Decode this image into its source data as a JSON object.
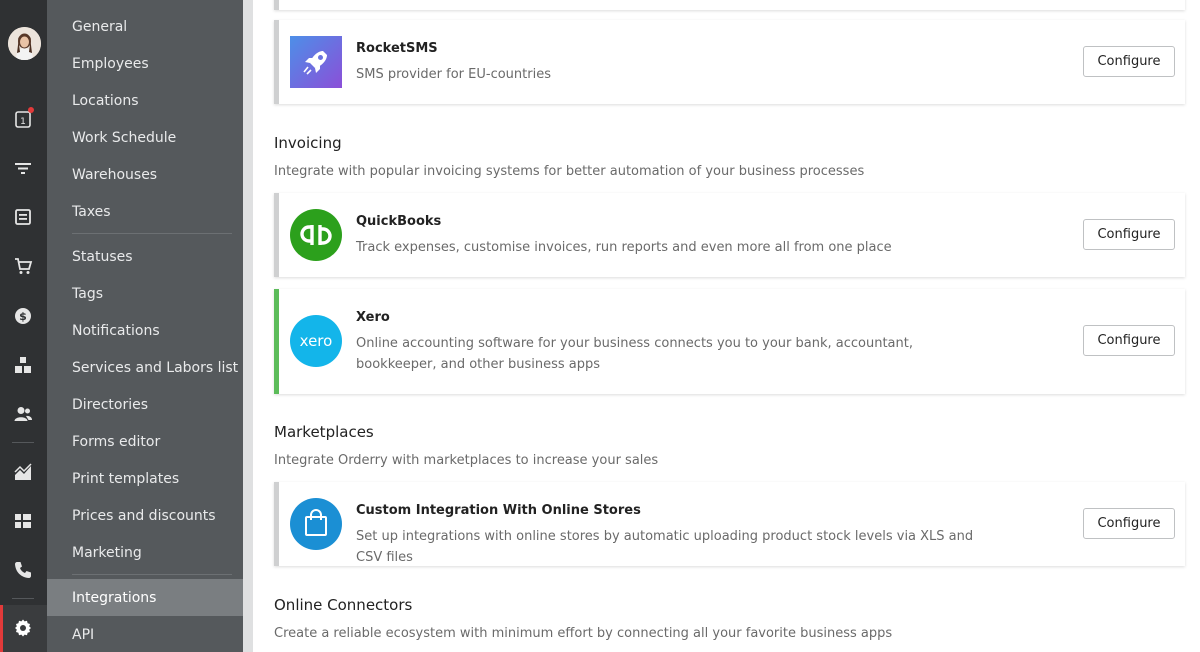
{
  "rail": {
    "icons": [
      "calendar-icon",
      "filter-icon",
      "orders-icon",
      "cart-icon",
      "money-icon",
      "warehouse-icon",
      "contacts-icon",
      "analytics-icon",
      "dashboard-icon",
      "phone-icon",
      "gear-icon"
    ],
    "calendar_day": "1",
    "accent_color": "#e23a3a"
  },
  "menu": {
    "items": [
      "General",
      "Employees",
      "Locations",
      "Work Schedule",
      "Warehouses",
      "Taxes",
      "Statuses",
      "Tags",
      "Notifications",
      "Services and Labors list",
      "Directories",
      "Forms editor",
      "Print templates",
      "Prices and discounts",
      "Marketing",
      "Integrations",
      "API"
    ],
    "active": "Integrations"
  },
  "rocketsms": {
    "title": "RocketSMS",
    "desc": "SMS provider for EU-countries",
    "button": "Configure"
  },
  "invoicing": {
    "title": "Invoicing",
    "subtitle": "Integrate with popular invoicing systems for better automation of your business processes",
    "quickbooks": {
      "title": "QuickBooks",
      "desc": "Track expenses, customise invoices, run reports and even more all from one place",
      "button": "Configure",
      "logo_text": "qb"
    },
    "xero": {
      "title": "Xero",
      "desc": "Online accounting software for your business connects you to your bank, accountant, bookkeeper, and other business apps",
      "button": "Configure",
      "logo_text": "xero"
    }
  },
  "marketplaces": {
    "title": "Marketplaces",
    "subtitle": "Integrate Orderry with marketplaces to increase your sales",
    "custom": {
      "title": "Custom Integration With Online Stores",
      "desc": "Set up integrations with online stores by automatic uploading product stock levels via XLS and CSV files",
      "button": "Configure"
    }
  },
  "connectors": {
    "title": "Online Connectors",
    "subtitle": "Create a reliable ecosystem with minimum effort by connecting all your favorite business apps"
  },
  "colors": {
    "quickbooks": "#2ca01c",
    "xero": "#13b5ea",
    "stores": "#1b8fd4",
    "rocketsms": "#5b6ee0",
    "active_card": "#5cbc5a"
  }
}
